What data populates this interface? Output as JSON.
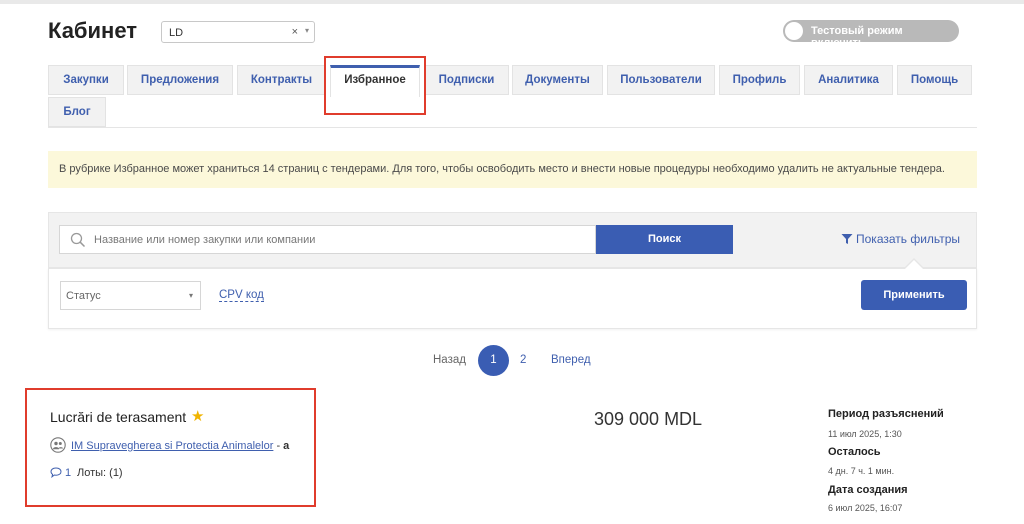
{
  "header": {
    "title": "Кабинет",
    "company_select": {
      "value": "LD",
      "clear_glyph": "×",
      "arrow_glyph": "▾"
    },
    "test_mode_toggle": {
      "label": "Тестовый режим включить",
      "enabled": false
    }
  },
  "tabs": [
    {
      "label": "Закупки",
      "active": false
    },
    {
      "label": "Предложения",
      "active": false
    },
    {
      "label": "Контракты",
      "active": false
    },
    {
      "label": "Избранное",
      "active": true
    },
    {
      "label": "Подписки",
      "active": false
    },
    {
      "label": "Документы",
      "active": false
    },
    {
      "label": "Пользователи",
      "active": false
    },
    {
      "label": "Профиль",
      "active": false
    },
    {
      "label": "Аналитика",
      "active": false
    },
    {
      "label": "Помощь",
      "active": false
    },
    {
      "label": "Блог",
      "active": false
    }
  ],
  "notice": "В рубрике Избранное может храниться 14 страниц с тендерами. Для того, чтобы освободить место и внести новые процедуры необходимо удалить не актуальные тендера.",
  "search": {
    "placeholder": "Название или номер закупки или компании",
    "button_label": "Поиск",
    "filters_link": "Показать фильтры"
  },
  "filters": {
    "status_select": {
      "value": "Статус",
      "arrow_glyph": "▾"
    },
    "cpv_link": "CPV код",
    "apply_label": "Применить"
  },
  "pagination": {
    "prev": "Назад",
    "current": "1",
    "next_page": "2",
    "next": "Вперед"
  },
  "tender": {
    "title": "Lucrări de terasament",
    "favorite_glyph": "★",
    "organization": "IM Supravegherea si Protectia Animalelor",
    "org_separator": " - ",
    "org_tail": "a",
    "comments_count": "1",
    "lots": "Лоты: (1)",
    "price": "309 000 MDL",
    "meta": [
      {
        "label": "Период разъяснений",
        "value": "11 июл 2025, 1:30"
      },
      {
        "label": "Осталось",
        "value": "4 дн. 7 ч. 1 мин."
      },
      {
        "label": "Дата создания",
        "value": "6 июл 2025, 16:07"
      }
    ]
  },
  "colors": {
    "accent": "#3a5db3",
    "highlight_box": "#e03c2c",
    "notice_bg": "#fcf8da",
    "star": "#f0b400"
  },
  "icons": {
    "search": "magnifier-icon",
    "filter": "funnel-icon",
    "organization": "group-icon",
    "comment": "speech-bubble-icon",
    "favorite": "star-icon"
  }
}
